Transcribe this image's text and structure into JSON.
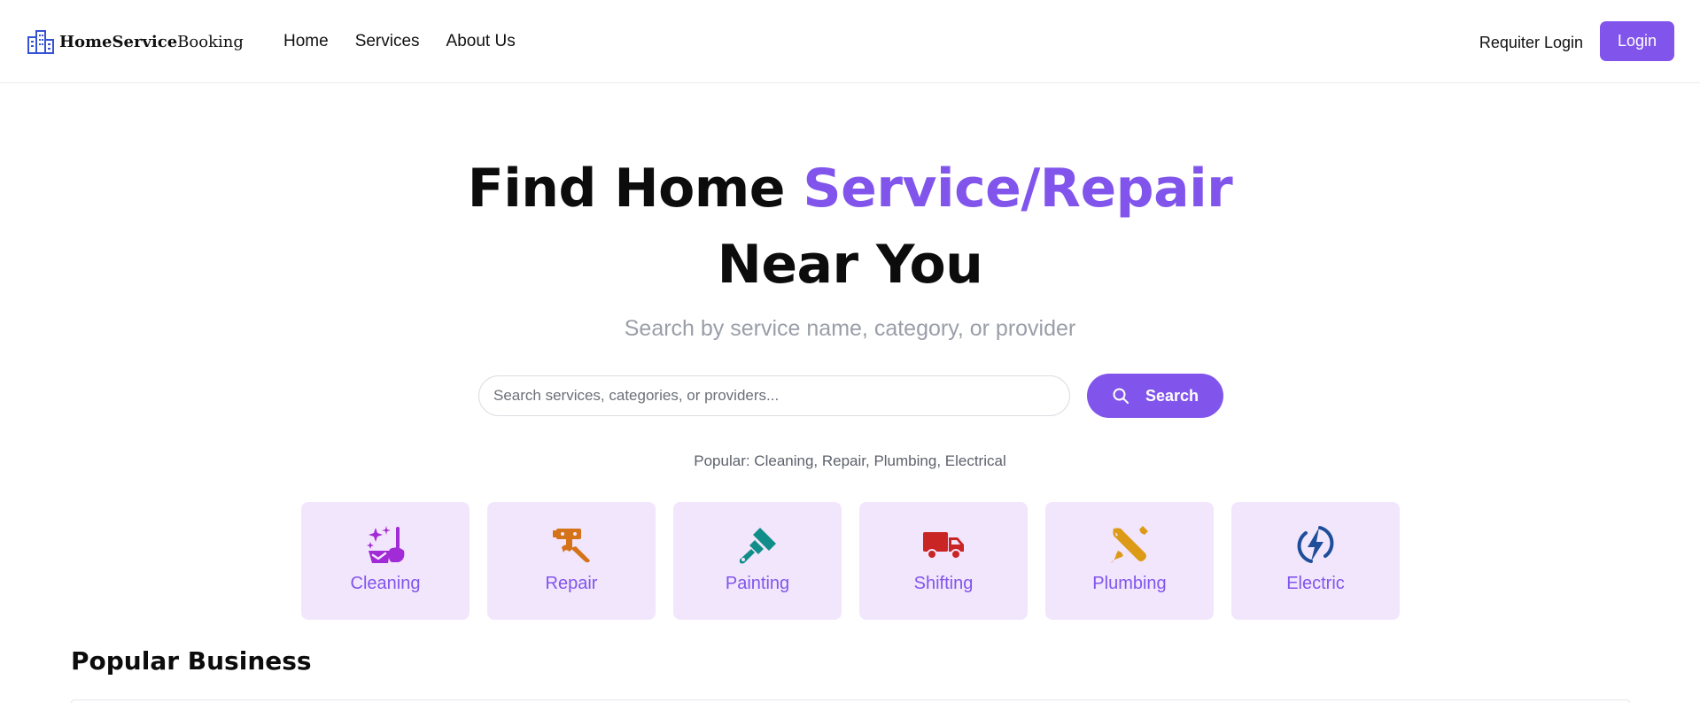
{
  "header": {
    "logo": {
      "bold": "HomeService",
      "regular": "Booking",
      "icon": "buildings-icon"
    },
    "nav": [
      {
        "label": "Home"
      },
      {
        "label": "Services"
      },
      {
        "label": "About Us"
      }
    ],
    "requiter_login": "Requiter Login",
    "login": "Login"
  },
  "hero": {
    "title_prefix": "Find Home ",
    "title_accent": "Service/Repair",
    "title_line2": "Near You",
    "subtitle": "Search by service name, category, or provider",
    "search_placeholder": "Search services, categories, or providers...",
    "search_button": "Search",
    "popular": "Popular: Cleaning, Repair, Plumbing, Electrical"
  },
  "categories": [
    {
      "label": "Cleaning",
      "icon": "cleaning-sparkle-icon",
      "color": "#a12bd6"
    },
    {
      "label": "Repair",
      "icon": "hammer-wrench-icon",
      "color": "#d4731a"
    },
    {
      "label": "Painting",
      "icon": "paint-brush-icon",
      "color": "#128e8a"
    },
    {
      "label": "Shifting",
      "icon": "truck-icon",
      "color": "#c92525"
    },
    {
      "label": "Plumbing",
      "icon": "wrench-screwdriver-icon",
      "color": "#dd9a16"
    },
    {
      "label": "Electric",
      "icon": "lightning-bolt-icon",
      "color": "#1e4e9a"
    }
  ],
  "section": {
    "title": "Popular Business"
  },
  "colors": {
    "accent": "#8155ec",
    "card_bg": "#f2e6fc"
  }
}
